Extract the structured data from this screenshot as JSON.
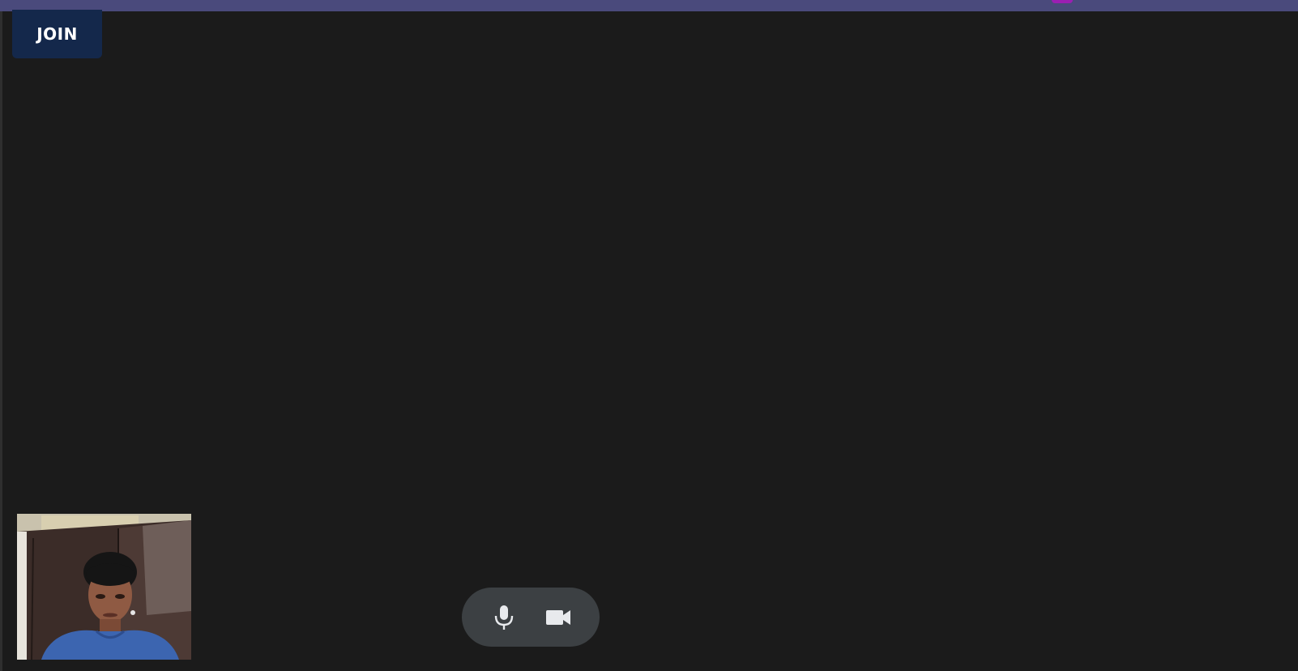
{
  "header": {
    "bar_color": "#4a4a7c",
    "indicator_color": "#9b1fb2"
  },
  "join_button": {
    "label": "JOIN",
    "color": "#14284b"
  },
  "main": {
    "background": "#1b1b1b"
  },
  "self_view": {
    "icon": "webcam-feed"
  },
  "controls": {
    "background": "#3c4043",
    "mic_icon": "microphone-icon",
    "camera_icon": "video-camera-icon"
  }
}
